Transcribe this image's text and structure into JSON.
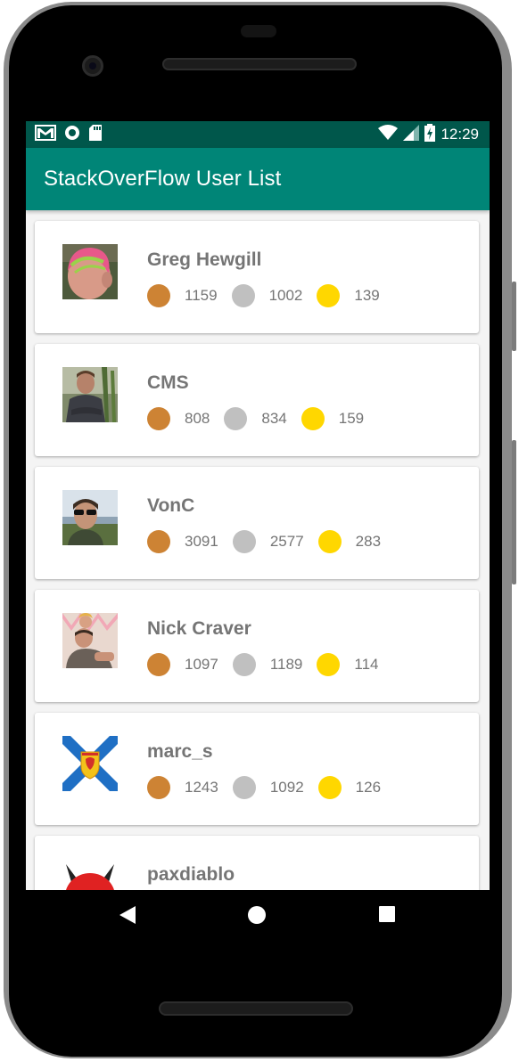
{
  "status_bar": {
    "time": "12:29",
    "left_icons": [
      "gmail-icon",
      "sync-circle-icon",
      "sd-card-icon"
    ],
    "right_icons": [
      "wifi-icon",
      "signal-icon",
      "battery-charging-icon"
    ]
  },
  "app_bar": {
    "title": "StackOverFlow User List",
    "color": "#008577",
    "status_color": "#00574b"
  },
  "badge_colors": {
    "bronze": "#cd8334",
    "silver": "#c0c0c0",
    "gold": "#ffd700"
  },
  "users": [
    {
      "name": "Greg Hewgill",
      "bronze": "1159",
      "silver": "1002",
      "gold": "139",
      "avatar": "pink-hair-avatar"
    },
    {
      "name": "CMS",
      "bronze": "808",
      "silver": "834",
      "gold": "159",
      "avatar": "man-arms-crossed-avatar"
    },
    {
      "name": "VonC",
      "bronze": "3091",
      "silver": "2577",
      "gold": "283",
      "avatar": "man-sunglasses-avatar"
    },
    {
      "name": "Nick Craver",
      "bronze": "1097",
      "silver": "1189",
      "gold": "114",
      "avatar": "man-with-child-avatar"
    },
    {
      "name": "marc_s",
      "bronze": "1243",
      "silver": "1092",
      "gold": "126",
      "avatar": "nova-scotia-flag-avatar"
    },
    {
      "name": "paxdiablo",
      "avatar": "red-devil-avatar"
    }
  ],
  "nav_bar": {
    "buttons": [
      "back-icon",
      "home-icon",
      "recents-icon"
    ]
  }
}
